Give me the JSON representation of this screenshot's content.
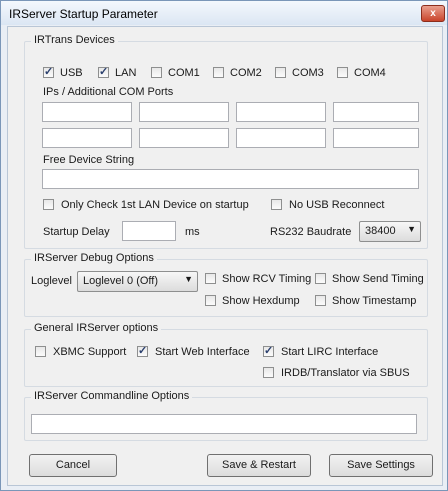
{
  "window": {
    "title": "IRServer Startup Parameter"
  },
  "irtrans_devices": {
    "group_title": "IRTrans Devices",
    "devices": [
      {
        "label": "USB",
        "checked": true
      },
      {
        "label": "LAN",
        "checked": true
      },
      {
        "label": "COM1",
        "checked": false
      },
      {
        "label": "COM2",
        "checked": false
      },
      {
        "label": "COM3",
        "checked": false
      },
      {
        "label": "COM4",
        "checked": false
      }
    ],
    "ips_label": "IPs / Additional COM Ports",
    "ip_fields": [
      "",
      "",
      "",
      "",
      "",
      "",
      "",
      ""
    ],
    "free_device_label": "Free Device String",
    "free_device_value": "",
    "only_check_lan_label": "Only Check 1st LAN Device on startup",
    "only_check_lan_checked": false,
    "no_usb_reconnect_label": "No USB Reconnect",
    "no_usb_reconnect_checked": false,
    "startup_delay_label": "Startup Delay",
    "startup_delay_value": "",
    "startup_delay_unit": "ms",
    "baudrate_label": "RS232 Baudrate",
    "baudrate_value": "38400"
  },
  "debug_options": {
    "group_title": "IRServer Debug Options",
    "loglevel_label": "Loglevel",
    "loglevel_value": "Loglevel 0 (Off)",
    "show_rcv_timing": {
      "label": "Show RCV Timing",
      "checked": false
    },
    "show_send_timing": {
      "label": "Show Send Timing",
      "checked": false
    },
    "show_hexdump": {
      "label": "Show Hexdump",
      "checked": false
    },
    "show_timestamp": {
      "label": "Show Timestamp",
      "checked": false
    }
  },
  "general_options": {
    "group_title": "General IRServer options",
    "xbmc_support": {
      "label": "XBMC Support",
      "checked": false
    },
    "start_web_interface": {
      "label": "Start Web Interface",
      "checked": true
    },
    "start_lirc_interface": {
      "label": "Start LIRC Interface",
      "checked": true
    },
    "irdb_translator": {
      "label": "IRDB/Translator via SBUS",
      "checked": false
    }
  },
  "commandline": {
    "group_title": "IRServer Commandline Options",
    "value": ""
  },
  "buttons": {
    "cancel": "Cancel",
    "save_restart": "Save & Restart",
    "save_settings": "Save Settings"
  }
}
